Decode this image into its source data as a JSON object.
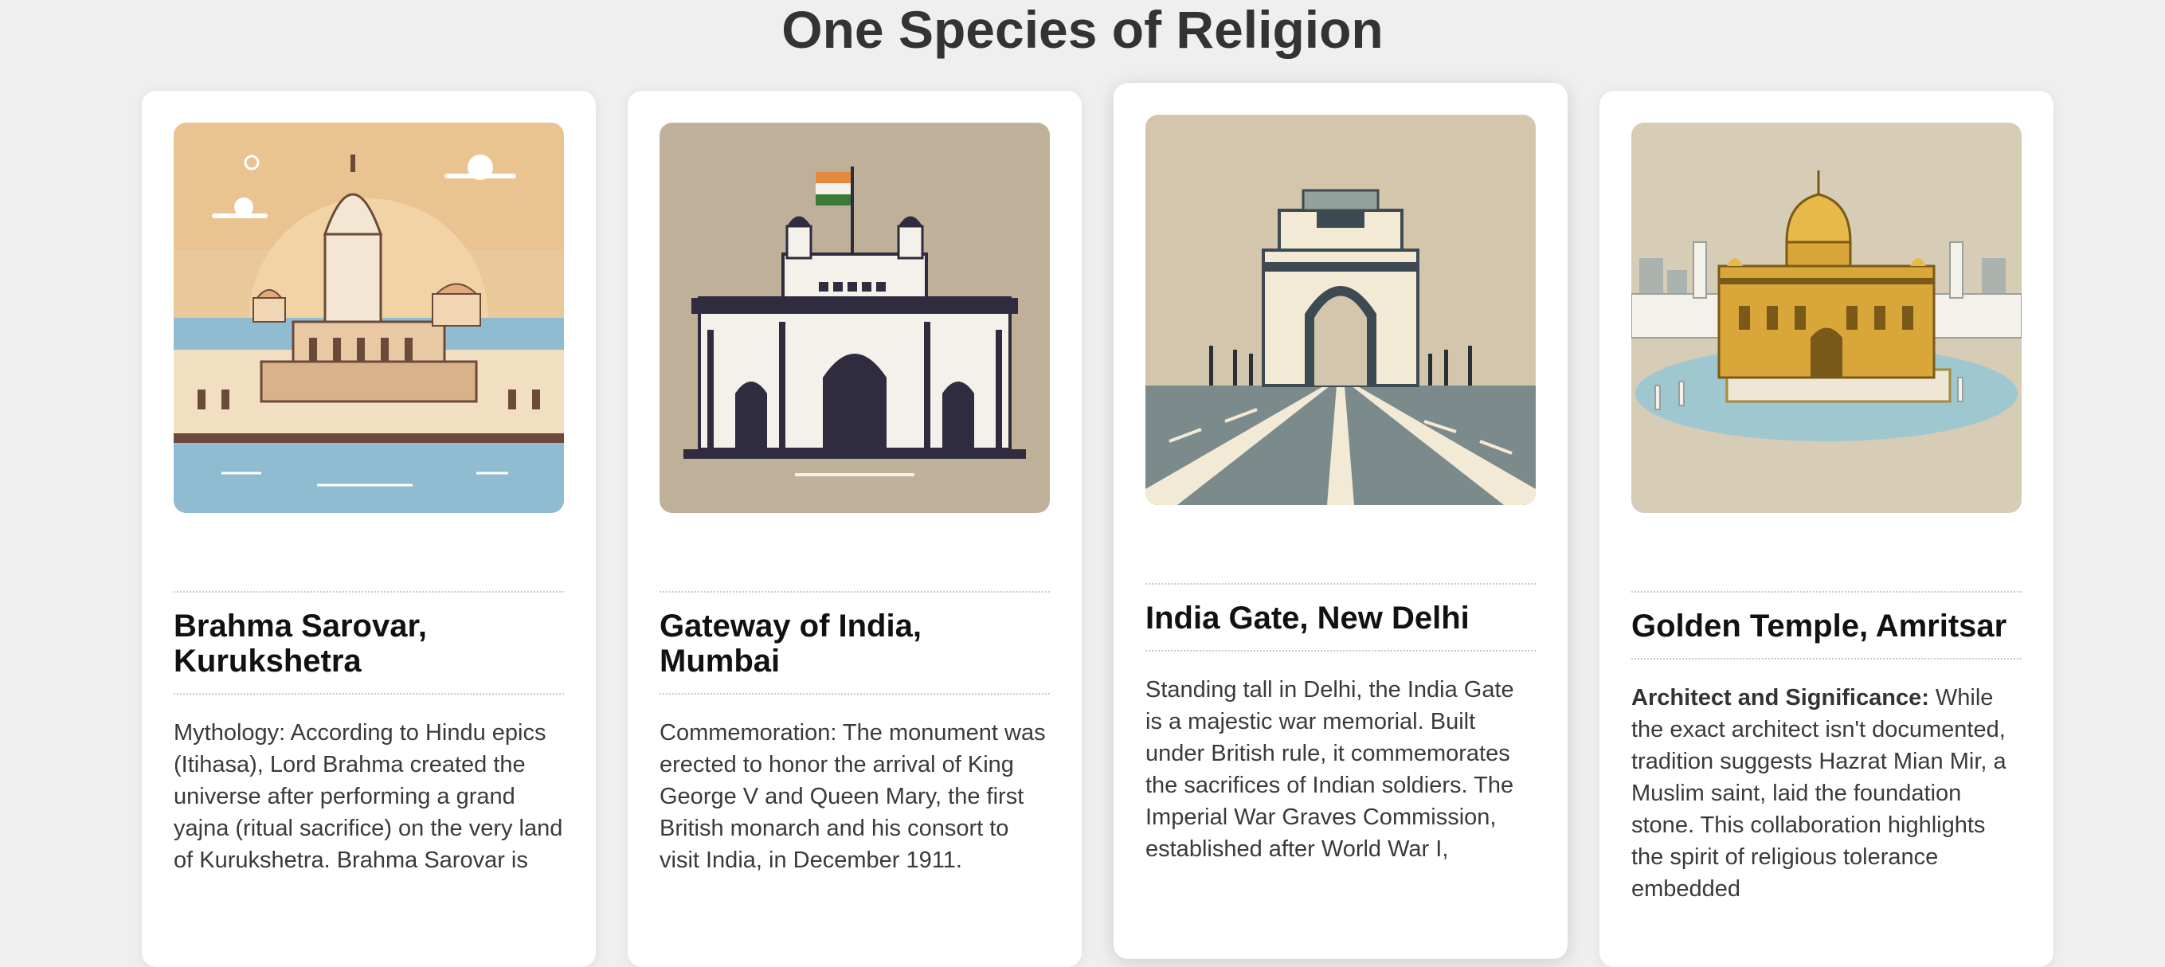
{
  "page": {
    "title": "One Species of Religion"
  },
  "cards": [
    {
      "title": "Brahma Sarovar, Kurukshetra",
      "text": "Mythology: According to Hindu epics (Itihasa), Lord Brahma created the universe after performing a grand yajna (ritual sacrifice) on the very land of Kurukshetra. Brahma Sarovar is",
      "image_icon": "temple-illustration",
      "palette": {
        "sky": "#e9c89a",
        "water": "#8fbcd0"
      }
    },
    {
      "title": "Gateway of India, Mumbai",
      "text": "Commemoration: The monument was erected to honor the arrival of King George V and Queen Mary, the first British monarch and his consort to visit India, in December 1911.",
      "image_icon": "gateway-illustration",
      "palette": {
        "background": "#bfb09a",
        "stone": "#2e2c3e"
      }
    },
    {
      "title": "India Gate, New Delhi",
      "text": "Standing tall in Delhi, the India Gate is a majestic war memorial. Built under British rule, it commemorates the sacrifices of Indian soldiers. The Imperial War Graves Commission, established after World War I,",
      "image_icon": "india-gate-illustration",
      "palette": {
        "background": "#d4c6ad",
        "road": "#7b8b8c"
      }
    },
    {
      "title": "Golden Temple, Amritsar",
      "text_bold": "Architect and Significance:",
      "text": "While the exact architect isn't documented, tradition suggests Hazrat Mian Mir, a Muslim saint, laid the foundation stone. This collaboration highlights the spirit of religious tolerance embedded",
      "image_icon": "golden-temple-illustration",
      "palette": {
        "background": "#d7ccb5",
        "gold": "#d9a63a"
      }
    }
  ]
}
